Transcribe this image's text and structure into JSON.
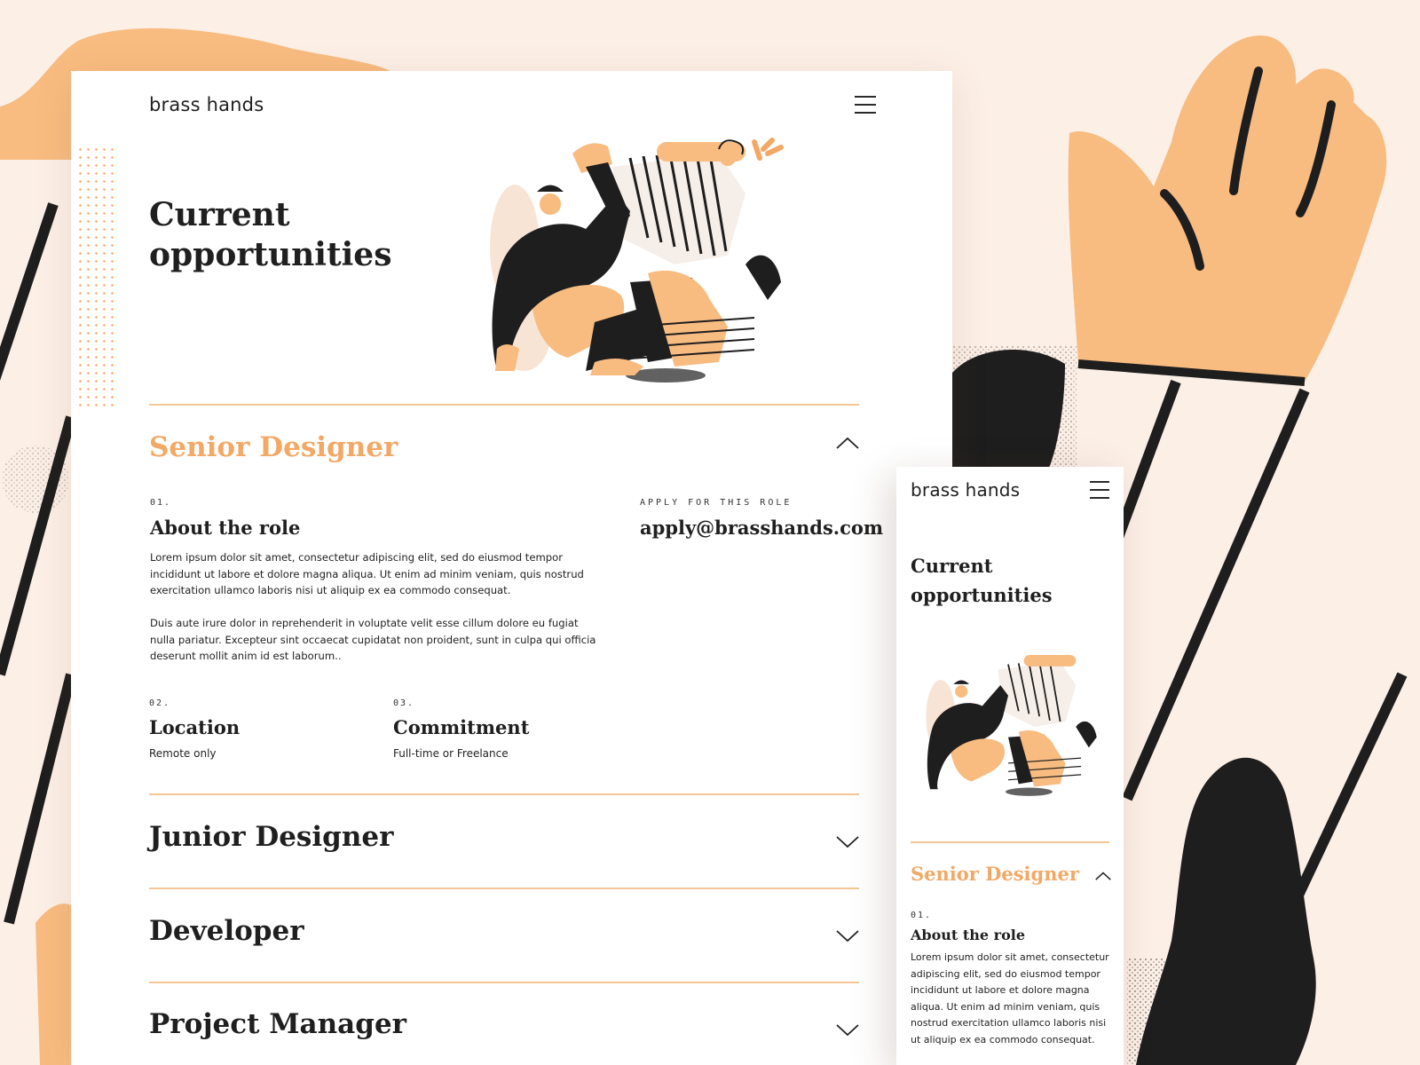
{
  "desktop": {
    "brand": "brass hands",
    "hero_title": "Current opportunities",
    "jobs": [
      {
        "title": "Senior Designer",
        "expanded": true,
        "about": {
          "number": "01.",
          "heading": "About the role",
          "para1": "Lorem ipsum dolor sit amet, consectetur adipiscing elit, sed do eiusmod tempor incididunt ut labore et dolore magna aliqua. Ut enim ad minim veniam, quis nostrud exercitation ullamco laboris nisi ut aliquip ex ea commodo consequat.",
          "para2": "Duis aute irure dolor in reprehenderit in voluptate velit esse cillum dolore eu fugiat nulla pariatur. Excepteur sint occaecat cupidatat non proident, sunt in culpa qui officia deserunt mollit anim id est laborum.."
        },
        "location": {
          "number": "02.",
          "heading": "Location",
          "value": "Remote only"
        },
        "commitment": {
          "number": "03.",
          "heading": "Commitment",
          "value": "Full-time or Freelance"
        },
        "apply_label": "APPLY FOR THIS ROLE",
        "apply_email": "apply@brasshands.com"
      },
      {
        "title": "Junior Designer",
        "expanded": false
      },
      {
        "title": "Developer",
        "expanded": false
      },
      {
        "title": "Project Manager",
        "expanded": false
      }
    ]
  },
  "mobile": {
    "brand": "brass hands",
    "hero_title": "Current opportunities",
    "job_title": "Senior Designer",
    "about_number": "01.",
    "about_heading": "About the role",
    "about_para": "Lorem ipsum dolor sit amet, consectetur adipiscing elit, sed do eiusmod tempor incididunt ut labore et dolore magna aliqua. Ut enim ad minim veniam, quis nostrud exercitation ullamco laboris nisi ut aliquip ex ea commodo consequat."
  },
  "colors": {
    "accent": "#f3a865",
    "background": "#fcefe6",
    "ink": "#1f1f1f",
    "rule": "#f5c796"
  },
  "icons": [
    "hamburger-menu-icon",
    "chevron-up-icon",
    "chevron-down-icon"
  ]
}
